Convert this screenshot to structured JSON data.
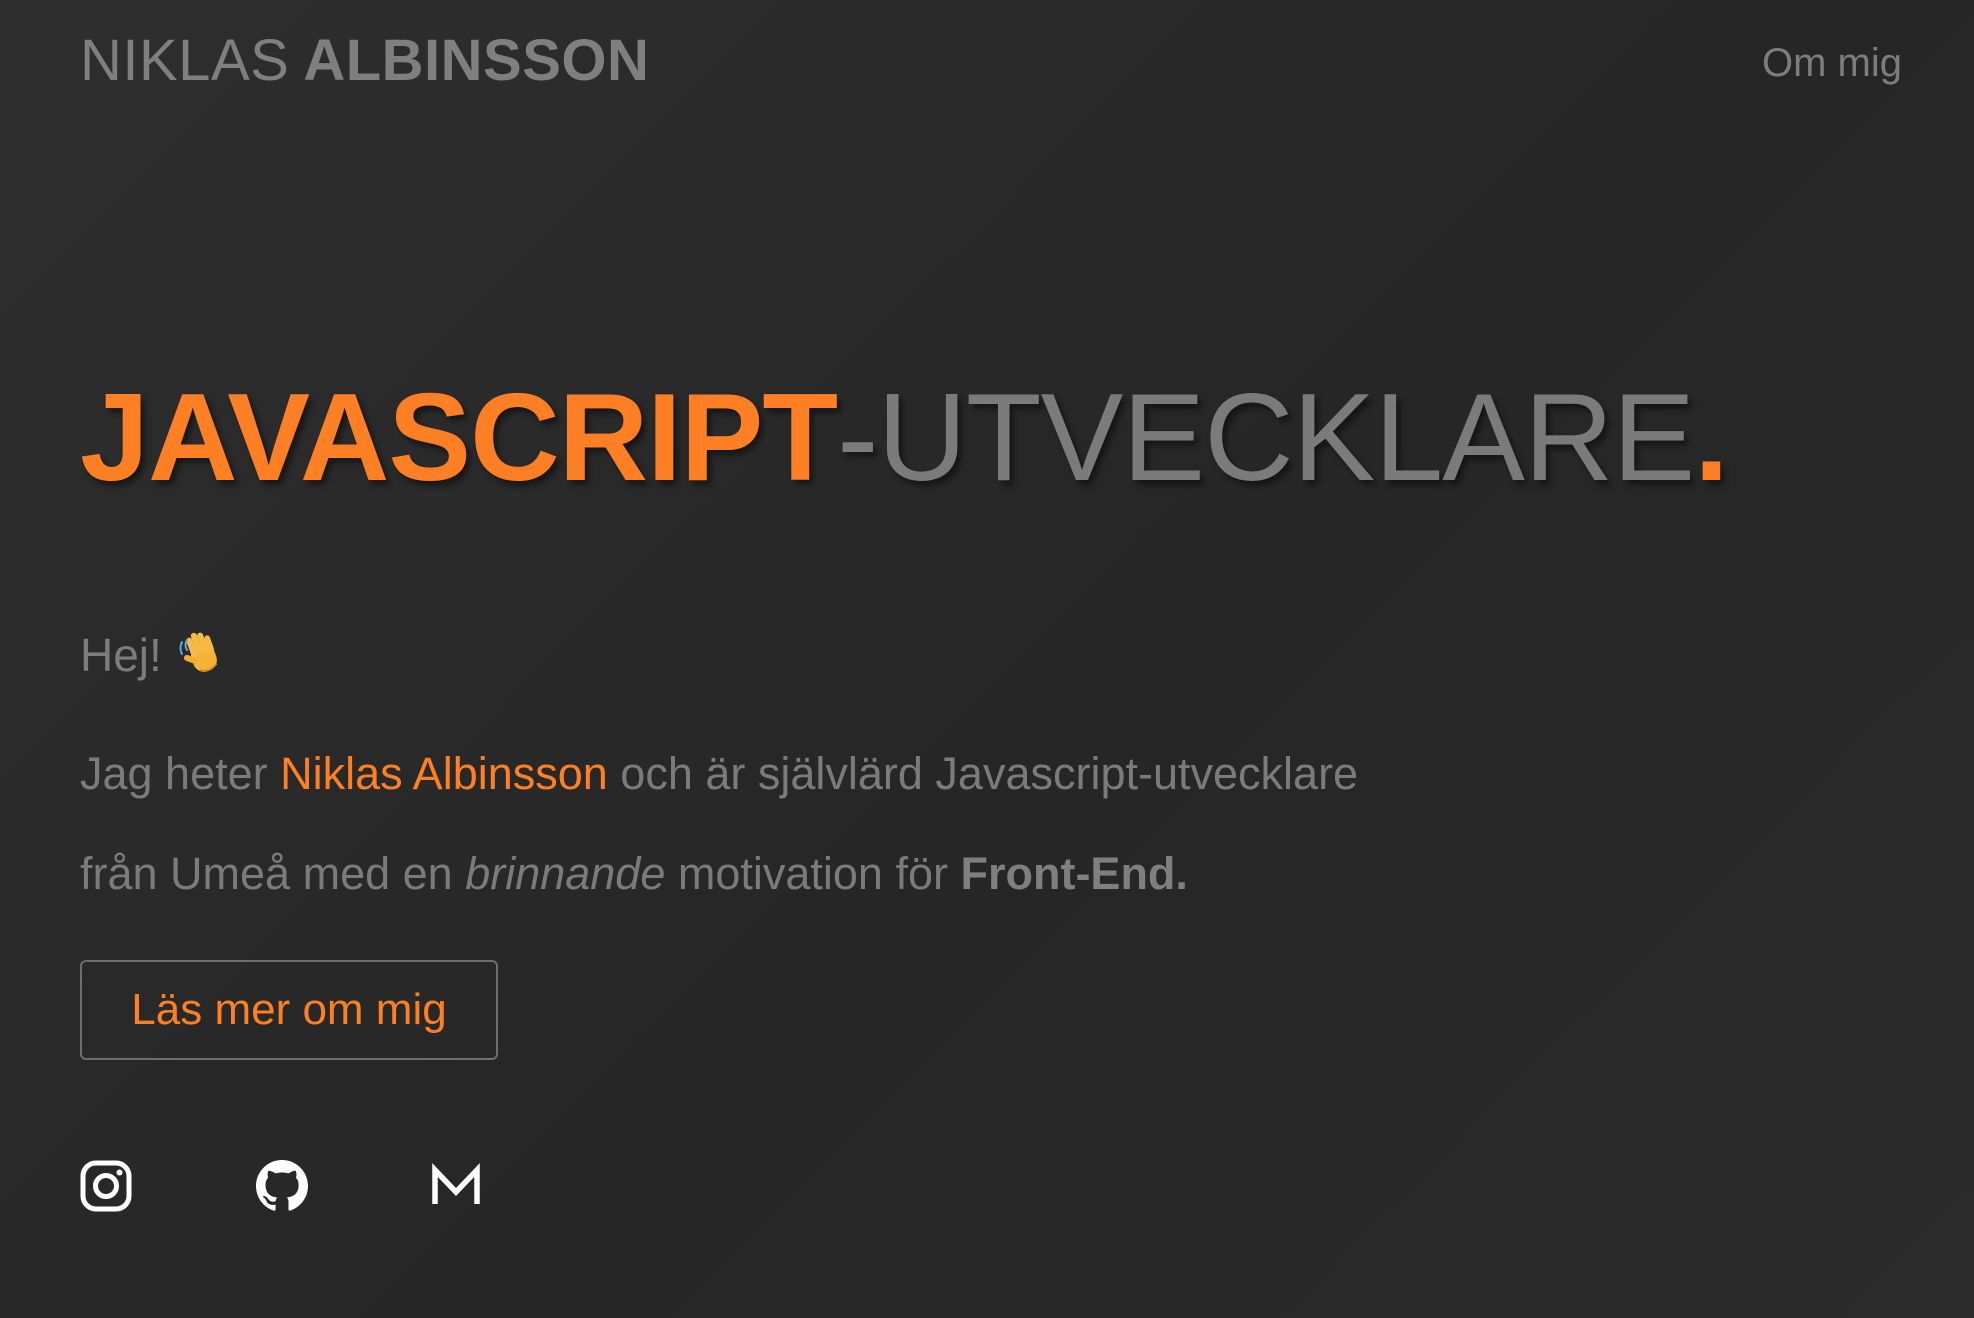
{
  "header": {
    "logo_first": "NIKLAS",
    "logo_last": "ALBINSSON",
    "nav_link": "Om mig"
  },
  "hero": {
    "title_accent": "JAVASCRIPT",
    "title_rest": "-UTVECKLARE",
    "title_dot": "."
  },
  "intro": {
    "greeting": "Hej!",
    "greeting_icon": "waving-hand-emoji",
    "line1_before": "Jag heter ",
    "line1_name": "Niklas Albinsson",
    "line1_after": " och är självlärd Javascript-utvecklare",
    "line2_before": "från Umeå med en ",
    "line2_em": "brinnande",
    "line2_mid": " motivation för ",
    "line2_strong": "Front-End."
  },
  "cta": {
    "label": "Läs mer om mig"
  },
  "socials": [
    {
      "name": "instagram-icon"
    },
    {
      "name": "github-icon"
    },
    {
      "name": "gmail-icon"
    }
  ],
  "colors": {
    "accent": "#ff7f24",
    "text": "#7d7d7d",
    "background": "#2a2a2a",
    "icon": "#ffffff"
  }
}
